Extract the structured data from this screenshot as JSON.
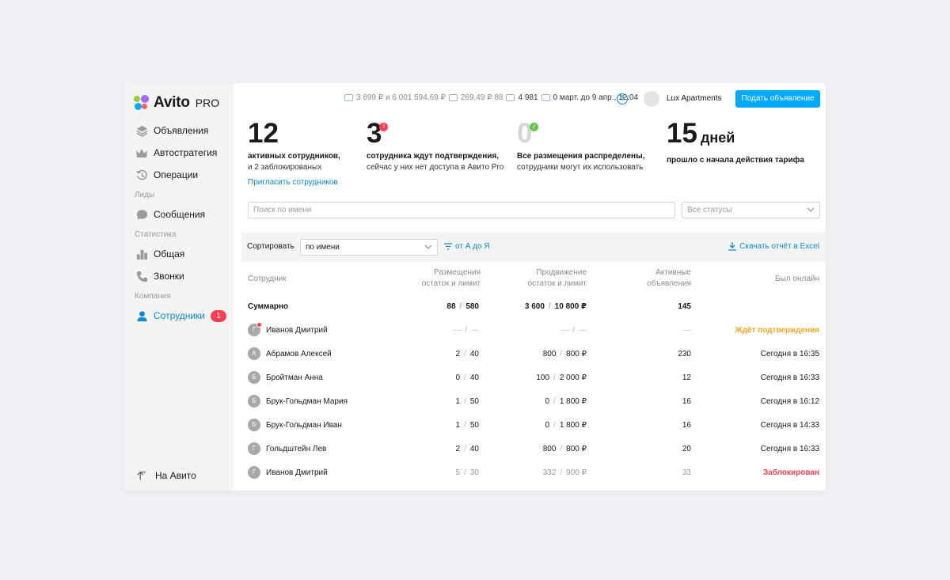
{
  "brand": {
    "name": "Avito",
    "pro": "PRO"
  },
  "sidebar": {
    "items": [
      {
        "label": "Объявления",
        "icon": "layers-icon"
      },
      {
        "label": "Автостратегия",
        "icon": "crown-icon"
      },
      {
        "label": "Операции",
        "icon": "history-icon"
      }
    ],
    "section_leads": "Лиды",
    "messages": "Сообщения",
    "section_stats": "Статистика",
    "stats_general": "Общая",
    "stats_calls": "Звонки",
    "section_company": "Компания",
    "employees": "Сотрудники",
    "employees_badge": "1",
    "back": "На Авито"
  },
  "header": {
    "balance_part1": "3 899 ₽ и 6 001 594,69 ₽",
    "balance_part2": "269,49 ₽ 88",
    "balance_part3": "4 981",
    "balance_part4": "0 март. до 9 апр., 12:04",
    "help": "?",
    "company": "Lux Apartments",
    "post_button": "Подать объявление"
  },
  "stats": [
    {
      "value": "12",
      "line1": "активных сотрудников,",
      "line2": "и 2 заблокированых",
      "link": "Пригласить сотрудников"
    },
    {
      "value": "3",
      "badge": "!",
      "line1": "сотрудника ждут подтверждения,",
      "line2": "сейчас у них нет доступа в Авито Pro"
    },
    {
      "value": "0",
      "badge": "✓",
      "line1": "Все размещения распределены,",
      "line2": "сотрудники могут их использовать"
    },
    {
      "value": "15",
      "unit": "дней",
      "line1": "прошло с начала действия тарифа"
    }
  ],
  "filters": {
    "search_placeholder": "Поиск по имени",
    "status": "Все статусы"
  },
  "sortbar": {
    "label": "Сортировать",
    "value": "по имени",
    "order": "от А до Я",
    "excel": "Скачать отчёт в Excel"
  },
  "table": {
    "headers": {
      "employee": "Сотрудник",
      "place_1": "Размещения",
      "place_2": "остаток и лимит",
      "promo_1": "Продвижение",
      "promo_2": "остаток и лимит",
      "ads_1": "Активные",
      "ads_2": "объявления",
      "online": "Был онлайн"
    },
    "summary": {
      "name": "Суммарно",
      "place_left": "88",
      "place_limit": "580",
      "promo_left": "3 600",
      "promo_limit": "10 800 ₽",
      "ads": "145"
    },
    "rows": [
      {
        "initial": "Г",
        "name": "Иванов Дмитрий",
        "place_left": "—",
        "place_limit": "—",
        "promo_left": "—",
        "promo_limit": "—",
        "ads": "—",
        "online": "Ждёт подтверждения"
      },
      {
        "initial": "А",
        "name": "Абрамов Алексей",
        "place_left": "2",
        "place_limit": "40",
        "promo_left": "800",
        "promo_limit": "800 ₽",
        "ads": "230",
        "online": "Сегодня в 16:35"
      },
      {
        "initial": "Б",
        "name": "Бройтман Анна",
        "place_left": "0",
        "place_limit": "40",
        "promo_left": "100",
        "promo_limit": "2 000 ₽",
        "ads": "12",
        "online": "Сегодня в 16:33"
      },
      {
        "initial": "Б",
        "name": "Брук-Гольдман Мария",
        "place_left": "1",
        "place_limit": "50",
        "promo_left": "0",
        "promo_limit": "1 800 ₽",
        "ads": "16",
        "online": "Сегодня в 16:12"
      },
      {
        "initial": "Б",
        "name": "Брук-Гольдман Иван",
        "place_left": "1",
        "place_limit": "50",
        "promo_left": "0",
        "promo_limit": "1 800 ₽",
        "ads": "16",
        "online": "Сегодня в 14:33"
      },
      {
        "initial": "Г",
        "name": "Гольдштейн Лев",
        "place_left": "2",
        "place_limit": "40",
        "promo_left": "800",
        "promo_limit": "800 ₽",
        "ads": "20",
        "online": "Сегодня в 16:33"
      },
      {
        "initial": "Г",
        "name": "Иванов Дмитрий",
        "place_left": "5",
        "place_limit": "30",
        "promo_left": "332",
        "promo_limit": "900 ₽",
        "ads": "33",
        "online": "Заблокирован"
      }
    ]
  },
  "colors": {
    "accent": "#00aaff",
    "link": "#0a8ad8",
    "alert": "#ff4053",
    "pending": "#f5a623",
    "ok": "#6cc24a"
  }
}
